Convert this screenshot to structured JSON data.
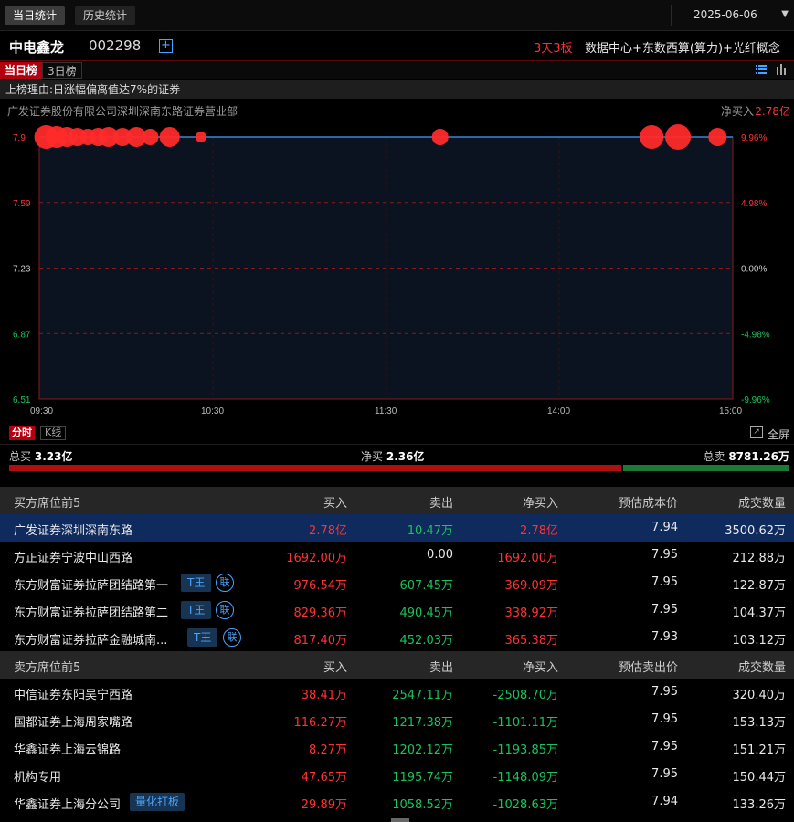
{
  "top_tabs": {
    "today": "当日统计",
    "history": "历史统计",
    "date": "2025-06-06",
    "date_arrow": "▼"
  },
  "stock": {
    "name": "中电鑫龙",
    "code": "002298",
    "add_symbol": "+",
    "board": "3天3板",
    "concepts": "数据中心+东数西算(算力)+光纤概念"
  },
  "rank_tabs": {
    "today": "当日榜",
    "three_day": "3日榜"
  },
  "reason": "上榜理由:日涨幅偏离值达7%的证券",
  "broker": {
    "name": "广发证券股份有限公司深圳深南东路证券营业部",
    "net_label": "净买入",
    "net_value": "2.78亿"
  },
  "chart_data": {
    "type": "line",
    "x": [
      "09:30",
      "10:30",
      "11:30",
      "14:00",
      "15:00"
    ],
    "y_left_ticks": [
      "7.9",
      "7.59",
      "7.23",
      "6.87",
      "6.51"
    ],
    "y_right_ticks": [
      "9.96%",
      "4.98%",
      "0.00%",
      "-4.98%",
      "-9.96%"
    ],
    "ylim": [
      6.51,
      7.95
    ],
    "price_line": 7.95,
    "bubbles": [
      {
        "t": 0.01,
        "size": 13
      },
      {
        "t": 0.025,
        "size": 12
      },
      {
        "t": 0.04,
        "size": 11
      },
      {
        "t": 0.055,
        "size": 10
      },
      {
        "t": 0.07,
        "size": 9
      },
      {
        "t": 0.085,
        "size": 10
      },
      {
        "t": 0.1,
        "size": 11
      },
      {
        "t": 0.12,
        "size": 10
      },
      {
        "t": 0.14,
        "size": 11
      },
      {
        "t": 0.16,
        "size": 9
      },
      {
        "t": 0.188,
        "size": 11
      },
      {
        "t": 0.233,
        "size": 6
      },
      {
        "t": 0.578,
        "size": 9
      },
      {
        "t": 0.883,
        "size": 13
      },
      {
        "t": 0.921,
        "size": 14
      },
      {
        "t": 0.978,
        "size": 10
      }
    ],
    "colors": {
      "line": "#3a86d8",
      "bubble": "#ff2a2a",
      "up": "#ff3232",
      "down": "#19c35a"
    }
  },
  "chart_tabs": {
    "timeshare": "分时",
    "kline": "K线",
    "fullscreen": "全屏",
    "fullscreen_icon": "↗"
  },
  "summary": {
    "total_buy_label": "总买",
    "total_buy": "3.23亿",
    "net_buy_label": "净买",
    "net_buy": "2.36亿",
    "total_sell_label": "总卖",
    "total_sell": "8781.26万",
    "buy_ratio": 0.786
  },
  "buy_table": {
    "headers": [
      "买方席位前5",
      "买入",
      "卖出",
      "净买入",
      "预估成本价",
      "成交数量"
    ],
    "rows": [
      {
        "name": "广发证券深圳深南东路",
        "buy": "2.78亿",
        "sell": "10.47万",
        "net": "2.78亿",
        "price": "7.94",
        "volume": "3500.62万",
        "tags": []
      },
      {
        "name": "方正证券宁波中山西路",
        "buy": "1692.00万",
        "sell": "0.00",
        "net": "1692.00万",
        "price": "7.95",
        "volume": "212.88万",
        "tags": []
      },
      {
        "name": "东方财富证券拉萨团结路第一",
        "buy": "976.54万",
        "sell": "607.45万",
        "net": "369.09万",
        "price": "7.95",
        "volume": "122.87万",
        "tags": [
          "T王",
          "联"
        ]
      },
      {
        "name": "东方财富证券拉萨团结路第二",
        "buy": "829.36万",
        "sell": "490.45万",
        "net": "338.92万",
        "price": "7.95",
        "volume": "104.37万",
        "tags": [
          "T王",
          "联"
        ]
      },
      {
        "name": "东方财富证券拉萨金融城南...",
        "buy": "817.40万",
        "sell": "452.03万",
        "net": "365.38万",
        "price": "7.93",
        "volume": "103.12万",
        "tags": [
          "T王",
          "联"
        ]
      }
    ]
  },
  "sell_table": {
    "headers": [
      "卖方席位前5",
      "买入",
      "卖出",
      "净买入",
      "预估卖出价",
      "成交数量"
    ],
    "rows": [
      {
        "name": "中信证券东阳吴宁西路",
        "buy": "38.41万",
        "sell": "2547.11万",
        "net": "-2508.70万",
        "price": "7.95",
        "volume": "320.40万",
        "tags": []
      },
      {
        "name": "国都证券上海周家嘴路",
        "buy": "116.27万",
        "sell": "1217.38万",
        "net": "-1101.11万",
        "price": "7.95",
        "volume": "153.13万",
        "tags": []
      },
      {
        "name": "华鑫证券上海云锦路",
        "buy": "8.27万",
        "sell": "1202.12万",
        "net": "-1193.85万",
        "price": "7.95",
        "volume": "151.21万",
        "tags": []
      },
      {
        "name": "机构专用",
        "buy": "47.65万",
        "sell": "1195.74万",
        "net": "-1148.09万",
        "price": "7.95",
        "volume": "150.44万",
        "tags": []
      },
      {
        "name": "华鑫证券上海分公司",
        "buy": "29.89万",
        "sell": "1058.52万",
        "net": "-1028.63万",
        "price": "7.94",
        "volume": "133.26万",
        "tags": [
          "量化打板"
        ]
      }
    ]
  }
}
